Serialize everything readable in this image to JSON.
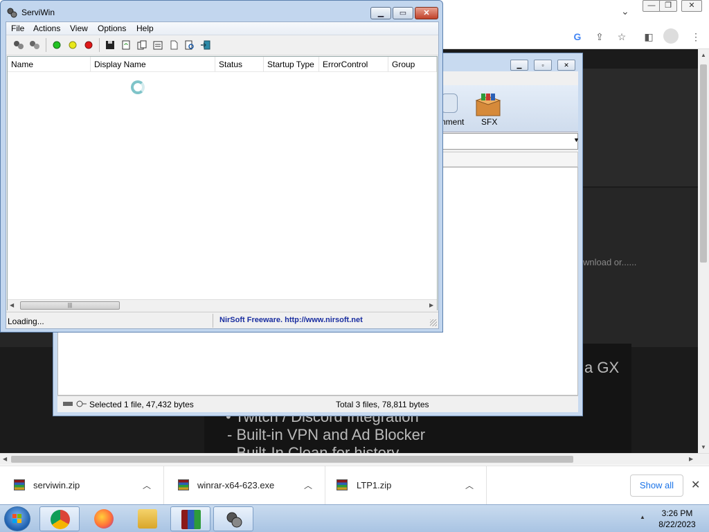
{
  "browser": {
    "background_text": {
      "download": "wnload or......",
      "gx": "a GX",
      "twitch": "• Twitch / Discord Integration",
      "vpn": "- Built-in VPN and Ad Blocker",
      "clean": "- Built-In Clean for history"
    },
    "downloads": [
      {
        "name": "serviwin.zip"
      },
      {
        "name": "winrar-x64-623.exe"
      },
      {
        "name": "LTP1.zip"
      }
    ],
    "show_all_label": "Show all"
  },
  "winrar": {
    "toolbar": {
      "comment_label": "nment",
      "sfx_label": "SFX"
    },
    "status_left": "Selected 1 file, 47,432 bytes",
    "status_right": "Total 3 files, 78,811 bytes"
  },
  "serviwin": {
    "title": "ServiWin",
    "menu": [
      "File",
      "Actions",
      "View",
      "Options",
      "Help"
    ],
    "columns": [
      "Name",
      "Display Name",
      "Status",
      "Startup Type",
      "ErrorControl",
      "Group"
    ],
    "status_text": "Loading...",
    "link_text": "NirSoft Freeware.  http://www.nirsoft.net"
  },
  "taskbar": {
    "time": "3:26 PM",
    "date": "8/22/2023"
  },
  "colors": {
    "link": "#1a2ea0",
    "chrome_accent": "#1a73e8"
  }
}
